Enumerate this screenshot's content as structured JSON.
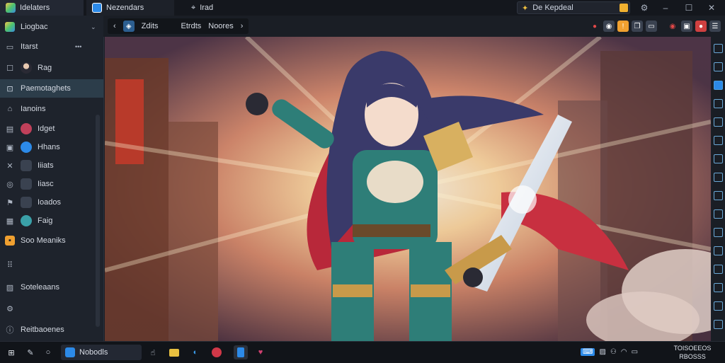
{
  "titlebar": {
    "app_label": "Idelaters",
    "tab1_label": "Nezendars",
    "tab2_label": "Irad",
    "address_text": "De Kepdeal"
  },
  "sidebar": {
    "header_label": "Liogbac",
    "section_label": "Itarst",
    "items": [
      {
        "label": "Rag"
      },
      {
        "label": "Paemotaghets"
      },
      {
        "label": "Ianoins"
      },
      {
        "label": "Idget"
      },
      {
        "label": "Hhans"
      },
      {
        "label": "Iiiats"
      },
      {
        "label": "Iiasc"
      },
      {
        "label": "Ioados"
      },
      {
        "label": "Faig"
      },
      {
        "label": "Soo Meaniks"
      },
      {
        "label": "Soteleaans"
      },
      {
        "label": "Reitbaoenes"
      }
    ]
  },
  "toolbar": {
    "nav_label1": "Zdits",
    "nav_label2": "Etrdts",
    "nav_label3": "Noores"
  },
  "taskbar": {
    "search_label": "Nobodls",
    "clock_time": "TOISOEEOS",
    "clock_date": "RBOSSS"
  },
  "colors": {
    "accent": "#2c8ae8",
    "selected": "#2c3d4a",
    "background": "#1b1f27"
  }
}
